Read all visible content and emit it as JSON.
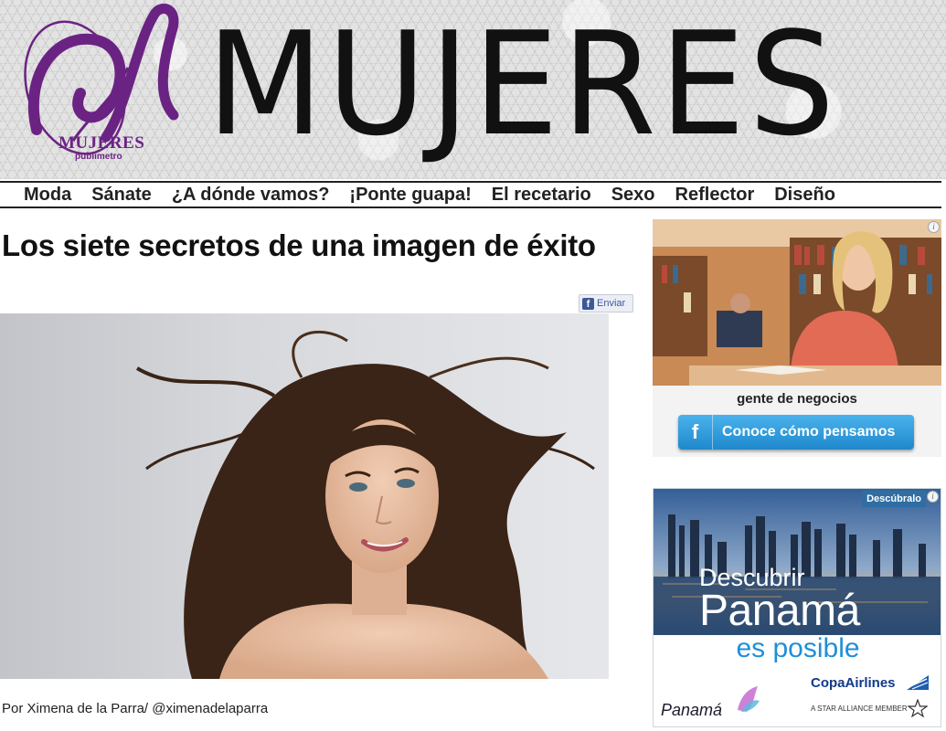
{
  "site": {
    "masthead": "MUJERES",
    "logo_text": "MUJERES",
    "logo_subtext": "publimetro"
  },
  "nav": {
    "items": [
      {
        "label": "Moda"
      },
      {
        "label": "Sánate"
      },
      {
        "label": "¿A dónde vamos?"
      },
      {
        "label": "¡Ponte guapa!"
      },
      {
        "label": "El recetario"
      },
      {
        "label": "Sexo"
      },
      {
        "label": "Reflector"
      },
      {
        "label": "Diseño"
      }
    ]
  },
  "article": {
    "title": "Los siete secretos de una imagen de éxito",
    "share_label": "Enviar",
    "byline": "Por Ximena de la Parra/ @ximenadelaparra"
  },
  "ads": {
    "info_glyph": "i",
    "ad1": {
      "caption": "gente de negocios",
      "button_icon": "f",
      "button_label": "Conoce cómo pensamos"
    },
    "ad2": {
      "badge": "Descúbralo",
      "line1": "Descubrir",
      "line2": "Panamá",
      "line3": "es posible",
      "brand_left": "Panamá",
      "brand_right": "CopaAirlines",
      "alliance": "A STAR ALLIANCE MEMBER"
    }
  },
  "colors": {
    "logo_purple": "#6b2383",
    "nav_text": "#222222",
    "facebook_blue": "#3b5998",
    "ad_button_blue": "#1f88cd",
    "panama_blue": "#1f8fd8",
    "copa_blue": "#123a8a"
  },
  "icons": {
    "logo": "mujeres-logo-icon",
    "facebook": "facebook-icon",
    "info": "info-icon",
    "copa": "copa-logo-icon",
    "star_alliance": "star-alliance-icon",
    "panama_brand": "panama-brand-icon"
  }
}
